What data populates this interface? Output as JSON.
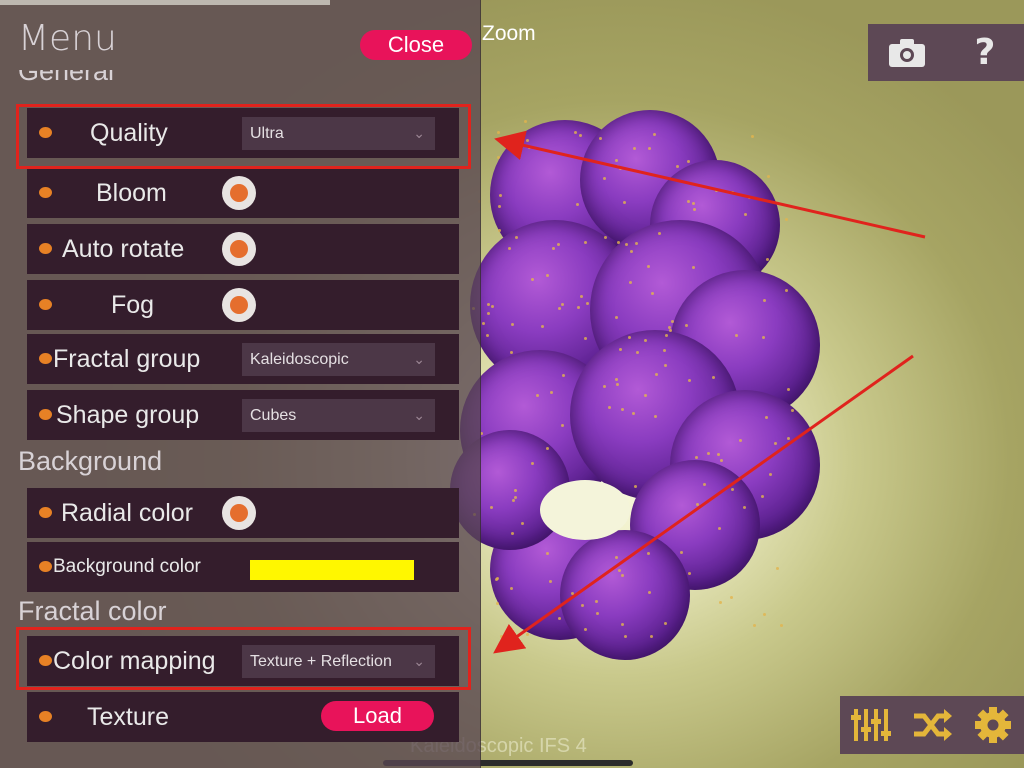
{
  "viewport": {
    "zoom_label": "Zoom",
    "fractal_title": "Kaleidoscopic IFS 4"
  },
  "menu": {
    "title": "Menu",
    "close_label": "Close",
    "sections": {
      "general": "General",
      "background": "Background",
      "fractal_color": "Fractal color"
    },
    "rows": {
      "quality": {
        "label": "Quality",
        "value": "Ultra"
      },
      "bloom": {
        "label": "Bloom"
      },
      "auto_rotate": {
        "label": "Auto rotate"
      },
      "fog": {
        "label": "Fog"
      },
      "fractal_group": {
        "label": "Fractal group",
        "value": "Kaleidoscopic"
      },
      "shape_group": {
        "label": "Shape group",
        "value": "Cubes"
      },
      "radial_color": {
        "label": "Radial color"
      },
      "background_color": {
        "label": "Background color",
        "color": "#fff700"
      },
      "color_mapping": {
        "label": "Color mapping",
        "value": "Texture + Reflection"
      },
      "texture": {
        "label": "Texture",
        "button": "Load"
      }
    }
  },
  "toolbar_top": {
    "icons": [
      "camera-icon",
      "help-icon"
    ],
    "help_glyph": "?"
  },
  "toolbar_bottom": {
    "icons": [
      "sliders-icon",
      "shuffle-icon",
      "settings-gear-icon"
    ]
  },
  "colors": {
    "accent": "#e8135a",
    "dot": "#e78125",
    "icon_yellow": "#e4b63a",
    "annotation_red": "#e0231d"
  }
}
